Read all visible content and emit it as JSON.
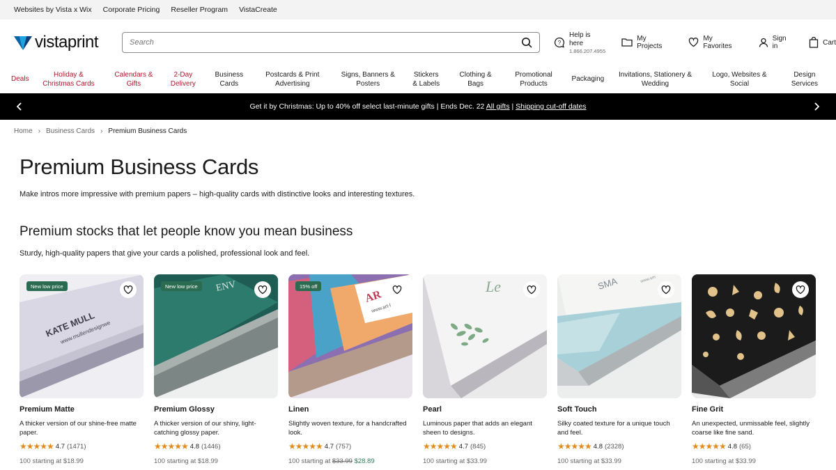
{
  "utility": [
    "Websites by Vista x Wix",
    "Corporate Pricing",
    "Reseller Program",
    "VistaCreate"
  ],
  "header": {
    "logo": "vistaprint",
    "search_placeholder": "Search",
    "help_title": "Help is here",
    "help_phone": "1.866.207.4955",
    "projects": "My Projects",
    "favorites": "My Favorites",
    "signin": "Sign in",
    "cart": "Cart"
  },
  "nav": [
    {
      "label": "Deals",
      "red": true
    },
    {
      "label": "Holiday & Christmas Cards",
      "red": true
    },
    {
      "label": "Calendars & Gifts",
      "red": true
    },
    {
      "label": "2-Day Delivery",
      "red": true
    },
    {
      "label": "Business Cards",
      "red": false
    },
    {
      "label": "Postcards & Print Advertising",
      "red": false
    },
    {
      "label": "Signs, Banners & Posters",
      "red": false
    },
    {
      "label": "Stickers & Labels",
      "red": false
    },
    {
      "label": "Clothing & Bags",
      "red": false
    },
    {
      "label": "Promotional Products",
      "red": false
    },
    {
      "label": "Packaging",
      "red": false
    },
    {
      "label": "Invitations, Stationery & Wedding",
      "red": false
    },
    {
      "label": "Logo, Websites & Social",
      "red": false
    },
    {
      "label": "Design Services",
      "red": false
    }
  ],
  "promo": {
    "text": "Get it by Christmas: Up to 40% off select last-minute gifts | Ends Dec. 22",
    "link1": "All gifts",
    "divider": "|",
    "link2": "Shipping cut-off dates"
  },
  "breadcrumb": [
    "Home",
    "Business Cards",
    "Premium Business Cards"
  ],
  "page": {
    "title": "Premium Business Cards",
    "intro": "Make intros more impressive with premium papers – high-quality cards with distinctive looks and interesting textures.",
    "section_title": "Premium stocks that let people know you mean business",
    "section_sub": "Sturdy, high-quality papers that give your cards a polished, professional look and feel."
  },
  "cards": [
    {
      "badge": "New low price",
      "title": "Premium Matte",
      "desc": "A thicker version of our shine-free matte paper.",
      "stars": "★★★★★",
      "rating": "4.7",
      "count": "(1471)",
      "price_prefix": "100 starting at ",
      "price": "$18.99",
      "old_price": "",
      "art_text1": "KATE MULL",
      "art_text2": "www.mullendesignwe"
    },
    {
      "badge": "New low price",
      "title": "Premium Glossy",
      "desc": "A thicker version of our shiny, light-catching glossy paper.",
      "stars": "★★★★★",
      "rating": "4.8",
      "count": "(1446)",
      "price_prefix": "100 starting at ",
      "price": "$18.99",
      "old_price": "",
      "art_text1": "ENV",
      "art_text2": ""
    },
    {
      "badge": "15% off",
      "title": "Linen",
      "desc": "Slightly woven texture, for a handcrafted look.",
      "stars": "★★★★★",
      "rating": "4.7",
      "count": "(757)",
      "price_prefix": "100 starting at ",
      "price": "$28.89",
      "old_price": "$33.99",
      "art_text1": "AR",
      "art_text2": "www.art-l"
    },
    {
      "badge": "",
      "title": "Pearl",
      "desc": "Luminous paper that adds an elegant sheen to designs.",
      "stars": "★★★★★",
      "rating": "4.7",
      "count": "(845)",
      "price_prefix": "100 starting at ",
      "price": "$33.99",
      "old_price": "",
      "art_text1": "Le",
      "art_text2": ""
    },
    {
      "badge": "",
      "title": "Soft Touch",
      "desc": "Silky coated texture for a unique touch and feel.",
      "stars": "★★★★★",
      "rating": "4.8",
      "count": "(2328)",
      "price_prefix": "100 starting at ",
      "price": "$33.99",
      "old_price": "",
      "art_text1": "SMA",
      "art_text2": "www.sm"
    },
    {
      "badge": "",
      "title": "Fine Grit",
      "desc": "An unexpected, unmissable feel, slightly coarse like fine sand.",
      "stars": "★★★★★",
      "rating": "4.8",
      "count": "(65)",
      "price_prefix": "100 starting at ",
      "price": "$33.99",
      "old_price": "",
      "art_text1": "",
      "art_text2": ""
    }
  ],
  "colors": {
    "accent_red": "#b2162b",
    "badge_green": "#2b6b52",
    "star_orange": "#e28b1b",
    "sale_green": "#2b7a55"
  }
}
